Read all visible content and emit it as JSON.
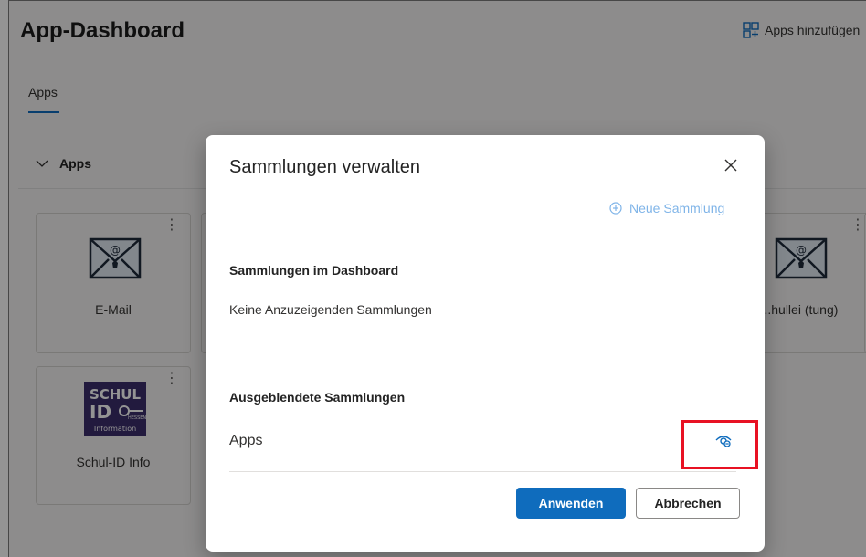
{
  "header": {
    "title": "App-Dashboard",
    "add_apps_label": "Apps hinzufügen",
    "add_apps_icon": "grid-add-icon"
  },
  "tabs": [
    {
      "label": "Apps"
    }
  ],
  "section": {
    "label": "Apps",
    "icon": "chevron-down-icon"
  },
  "tiles": [
    {
      "label": "E-Mail",
      "icon": "email-hessen-icon"
    },
    {
      "label": "Schul-ID Info",
      "icon": "schul-id-logo",
      "logo_text": [
        "SCHUL",
        "ID",
        "HESSEN",
        "Information"
      ]
    },
    {
      "label": "...hullei (tung)",
      "icon": "email-hessen-icon"
    }
  ],
  "dialog": {
    "title": "Sammlungen verwalten",
    "new_collection_label": "Neue Sammlung",
    "section_dashboard": "Sammlungen im Dashboard",
    "empty_text": "Keine Anzuzeigenden Sammlungen",
    "section_hidden": "Ausgeblendete Sammlungen",
    "hidden_items": [
      {
        "label": "Apps",
        "action_icon": "eye-unhide-icon"
      }
    ],
    "apply_label": "Anwenden",
    "cancel_label": "Abbrechen"
  },
  "colors": {
    "accent": "#0f6cbd",
    "highlight": "#e81123",
    "link_disabled": "#7fb4e8"
  }
}
